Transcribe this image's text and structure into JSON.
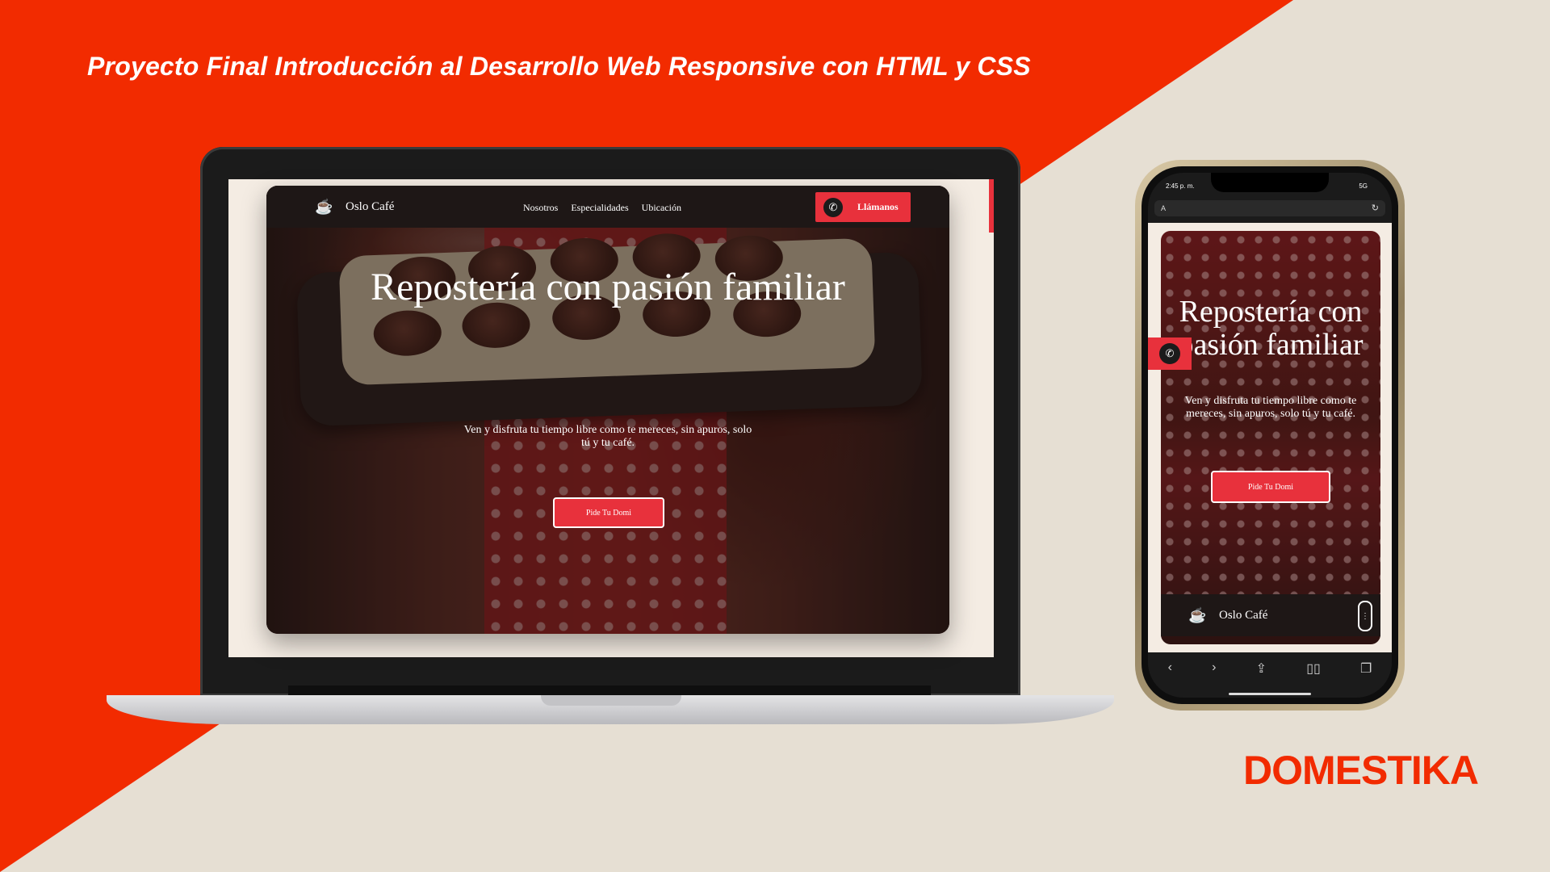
{
  "headline": "Proyecto Final Introducción al Desarrollo Web Responsive con HTML y CSS",
  "laptop_site": {
    "logo_icon": "coffee-cup-icon",
    "brand": "Oslo Café",
    "nav": [
      "Nosotros",
      "Especialidades",
      "Ubicación"
    ],
    "call_button": "Llámanos",
    "hero_title": "Repostería con pasión familiar",
    "hero_subtitle": "Ven y disfruta tu tiempo libre como te mereces, sin apuros, solo tú y tu café.",
    "cta": "Pide Tu Domi"
  },
  "phone": {
    "time": "2:45 p. m.",
    "signal": "5G",
    "url_text": "A",
    "hero_title": "Repostería con pasión familiar",
    "hero_subtitle": "Ven y disfruta tu tiempo libre como te mereces, sin apuros, solo tú y tu café.",
    "cta": "Pide Tu Domi",
    "footer_brand": "Oslo Café"
  },
  "brand_logo": "DOMESTIKA",
  "colors": {
    "accent_red": "#e8313c",
    "background_red": "#f22b00",
    "background_beige": "#e6dfd3",
    "dark": "#1e1716"
  }
}
